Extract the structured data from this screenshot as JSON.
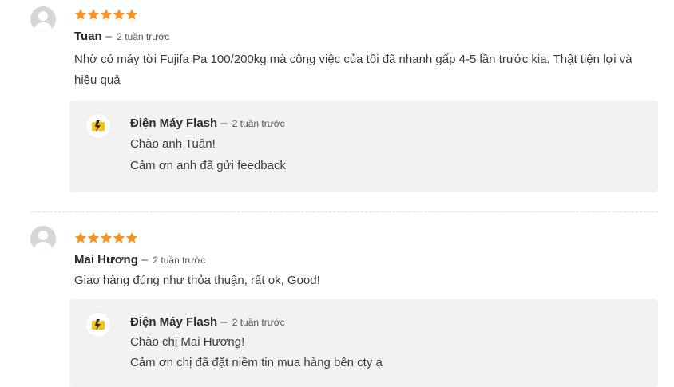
{
  "colors": {
    "star": "#f7941d",
    "reply_bg": "#f2f2f2",
    "logo": "#f2c21b"
  },
  "icons": {
    "avatar": "user-avatar-icon",
    "star": "star-icon",
    "logo": "dien-may-flash-logo-icon"
  },
  "reviews": [
    {
      "author": "Tuan",
      "separator": "–",
      "time": "2 tuần trước",
      "rating": 5,
      "text": "Nhờ có máy tời Fujifa Pa 100/200kg mà công việc của tôi đã nhanh gấp 4-5 lần trước kia. Thật tiện lợi và hiệu quả",
      "reply": {
        "author": "Điện Máy Flash",
        "separator": "–",
        "time": "2 tuần trước",
        "line1": "Chào anh Tuân!",
        "line2": "Cảm ơn anh đã gửi feedback"
      }
    },
    {
      "author": "Mai Hương",
      "separator": "–",
      "time": "2 tuần trước",
      "rating": 5,
      "text": "Giao hàng đúng như thỏa thuận, rất ok, Good!",
      "reply": {
        "author": "Điện Máy Flash",
        "separator": "–",
        "time": "2 tuần trước",
        "line1": "Chào chị Mai Hương!",
        "line2": "Cảm ơn chị đã đặt niềm tin mua hàng bên cty ạ"
      }
    }
  ]
}
